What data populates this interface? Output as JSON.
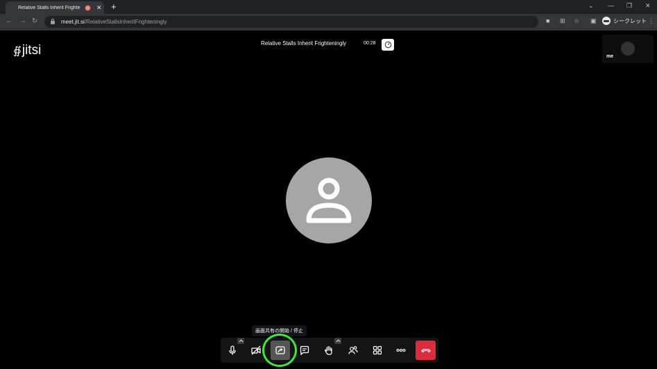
{
  "browser": {
    "tab_title": "Relative Stalls Inherit Frighte",
    "tab_close": "✕",
    "new_tab": "+",
    "url_host": "meet.jit.si",
    "url_path": "/RelativeStallsInheritFrighteningly",
    "profile_label": "シークレット",
    "window_minimize": "—",
    "window_restore": "❐",
    "window_close": "✕",
    "tab_search": "⌄"
  },
  "jitsi": {
    "logo_text": "jitsi",
    "meeting_title": "Relative Stalls Inherit Frighteningly",
    "timer": "00:28",
    "self_label": "me",
    "tooltip": "画面共有の開始 / 停止"
  },
  "colors": {
    "hangup": "#dd2b3e",
    "highlight_ring": "#3ee83a",
    "avatar": "#a6a6a6"
  },
  "toolbar_icons": [
    "microphone-icon",
    "camera-off-icon",
    "screen-share-icon",
    "chat-icon",
    "raise-hand-icon",
    "participants-icon",
    "tile-view-icon",
    "more-icon",
    "hangup-icon"
  ]
}
